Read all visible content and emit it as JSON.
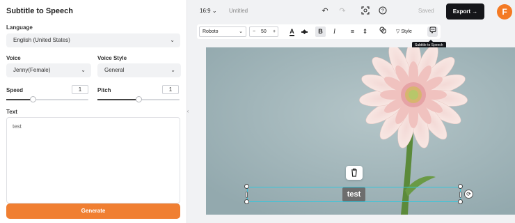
{
  "panel": {
    "title": "Subtitle to Speech",
    "language_label": "Language",
    "language_value": "English (United States)",
    "voice_label": "Voice",
    "voice_value": "Jenny(Female)",
    "voice_style_label": "Voice Style",
    "voice_style_value": "General",
    "speed_label": "Speed",
    "speed_value": "1",
    "pitch_label": "Pitch",
    "pitch_value": "1",
    "speed_fraction": 0.33,
    "pitch_fraction": 0.5,
    "text_label": "Text",
    "text_value": "test",
    "generate_label": "Generate",
    "generate_color": "#f07f32"
  },
  "topbar": {
    "ratio": "16:9",
    "title": "Untitled",
    "saved": "Saved",
    "export_label": "Export",
    "logo_letter": "F",
    "icons": [
      "undo-icon",
      "redo-icon",
      "screenshot-icon",
      "help-icon",
      "arrow-right-icon"
    ]
  },
  "toolbar": {
    "font": "Roboto",
    "minus": "−",
    "size": "50",
    "plus": "+",
    "style_label": "Style",
    "tooltip": "Subtitle to Speech",
    "icons": [
      "text-color-icon",
      "highlight-icon",
      "bold-icon",
      "italic-icon",
      "align-icon",
      "line-spacing-icon",
      "effects-icon",
      "style-icon",
      "subtitle-to-speech-icon"
    ]
  },
  "canvas": {
    "caption": "test",
    "selection_color": "#32c7dd",
    "background": "#a6b9bd"
  }
}
